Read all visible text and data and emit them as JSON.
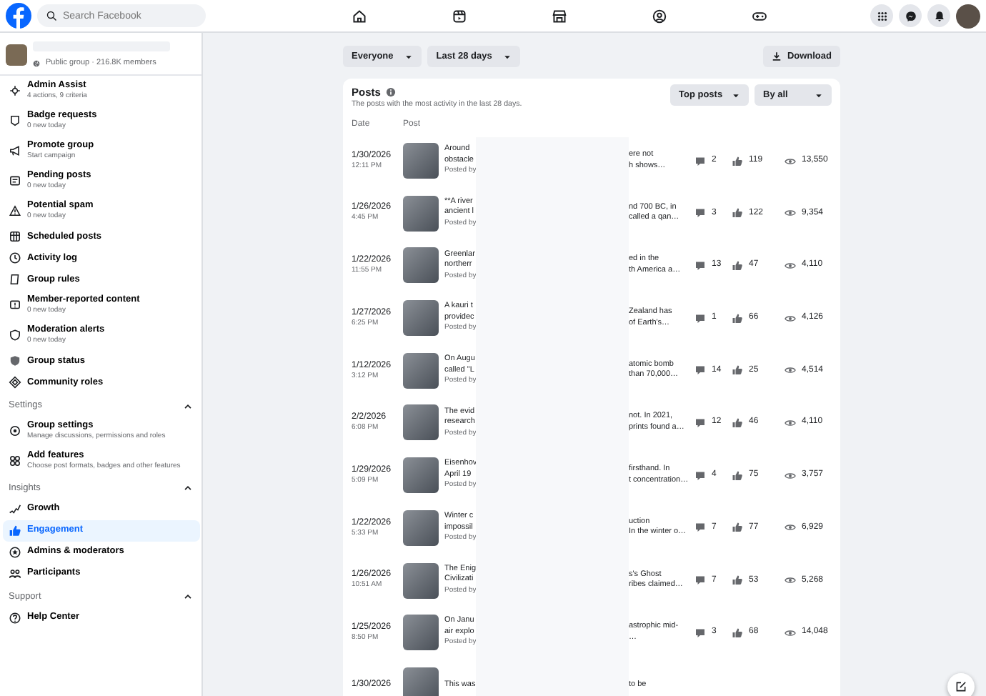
{
  "search": {
    "placeholder": "Search Facebook"
  },
  "sidebar": {
    "group_meta": "Public group · 216.8K members",
    "items": [
      {
        "kind": "item",
        "label": "Admin Assist",
        "sub": "4 actions, 9 criteria",
        "selected": false
      },
      {
        "kind": "item",
        "label": "Badge requests",
        "sub": "0 new today",
        "selected": false
      },
      {
        "kind": "item",
        "label": "Promote group",
        "sub": "Start campaign",
        "selected": false
      },
      {
        "kind": "item",
        "label": "Pending posts",
        "sub": "0 new today",
        "selected": false
      },
      {
        "kind": "item",
        "label": "Potential spam",
        "sub": "0 new today",
        "selected": false
      },
      {
        "kind": "item",
        "label": "Scheduled posts",
        "selected": false
      },
      {
        "kind": "item",
        "label": "Activity log",
        "selected": false
      },
      {
        "kind": "item",
        "label": "Group rules",
        "selected": false
      },
      {
        "kind": "item",
        "label": "Member-reported content",
        "sub": "0 new today",
        "selected": false
      },
      {
        "kind": "item",
        "label": "Moderation alerts",
        "sub": "0 new today",
        "selected": false
      },
      {
        "kind": "item",
        "label": "Group status",
        "selected": false
      },
      {
        "kind": "item",
        "label": "Community roles",
        "selected": false
      },
      {
        "kind": "section",
        "label": "Settings",
        "expanded": true
      },
      {
        "kind": "item",
        "label": "Group settings",
        "sub": "Manage discussions, permissions and roles",
        "selected": false
      },
      {
        "kind": "item",
        "label": "Add features",
        "sub": "Choose post formats, badges and other features",
        "selected": false
      },
      {
        "kind": "section",
        "label": "Insights",
        "expanded": true
      },
      {
        "kind": "item",
        "label": "Growth",
        "selected": false
      },
      {
        "kind": "item",
        "label": "Engagement",
        "selected": true
      },
      {
        "kind": "item",
        "label": "Admins & moderators",
        "selected": false
      },
      {
        "kind": "item",
        "label": "Participants",
        "selected": false
      },
      {
        "kind": "section",
        "label": "Support",
        "expanded": true
      },
      {
        "kind": "item",
        "label": "Help Center",
        "selected": false
      }
    ]
  },
  "filters": [
    "Everyone",
    "Last 28 days"
  ],
  "download": "Download",
  "posts": {
    "title": "Posts",
    "subtitle": "The posts with the most activity in the last 28 days.",
    "sort": [
      "Top posts",
      "By all"
    ],
    "columns": [
      "Date",
      "Post"
    ],
    "rows": [
      {
        "date": "1/30/2026",
        "time": "12:11 PM",
        "start": [
          "Around",
          "obstacle"
        ],
        "end": [
          "ere not",
          "h shows…"
        ],
        "posted_by": "Posted by",
        "comments": "2",
        "likes": "119",
        "views": "13,550"
      },
      {
        "date": "1/26/2026",
        "time": "4:45 PM",
        "start": [
          "**A river",
          "ancient l"
        ],
        "end": [
          "nd 700 BC, in",
          "called a qan…"
        ],
        "posted_by": "Posted by",
        "comments": "3",
        "likes": "122",
        "views": "9,354"
      },
      {
        "date": "1/22/2026",
        "time": "11:55 PM",
        "start": [
          "Greenlar",
          "northerr"
        ],
        "end": [
          "ed in the",
          "th America a…"
        ],
        "posted_by": "Posted by",
        "comments": "13",
        "likes": "47",
        "views": "4,110"
      },
      {
        "date": "1/27/2026",
        "time": "6:25 PM",
        "start": [
          "A kauri t",
          "providec"
        ],
        "end": [
          "Zealand has",
          "of Earth's…"
        ],
        "posted_by": "Posted by",
        "comments": "1",
        "likes": "66",
        "views": "4,126"
      },
      {
        "date": "1/12/2026",
        "time": "3:12 PM",
        "start": [
          "On Augu",
          "called \"L"
        ],
        "end": [
          "atomic bomb",
          "than 70,000…"
        ],
        "posted_by": "Posted by",
        "comments": "14",
        "likes": "25",
        "views": "4,514"
      },
      {
        "date": "2/2/2026",
        "time": "6:08 PM",
        "start": [
          "The evid",
          "research"
        ],
        "end": [
          "not. In 2021,",
          "prints found a…"
        ],
        "posted_by": "Posted by",
        "comments": "12",
        "likes": "46",
        "views": "4,110"
      },
      {
        "date": "1/29/2026",
        "time": "5:09 PM",
        "start": [
          "Eisenhov",
          "April 19"
        ],
        "end": [
          "firsthand. In",
          "t concentration…"
        ],
        "posted_by": "Posted by",
        "comments": "4",
        "likes": "75",
        "views": "3,757"
      },
      {
        "date": "1/22/2026",
        "time": "5:33 PM",
        "start": [
          "Winter c",
          "impossil"
        ],
        "end": [
          "uction",
          "In the winter o…"
        ],
        "posted_by": "Posted by",
        "comments": "7",
        "likes": "77",
        "views": "6,929"
      },
      {
        "date": "1/26/2026",
        "time": "10:51 AM",
        "start": [
          "The Enig",
          "Civilizati"
        ],
        "end": [
          "s's Ghost",
          "ribes claimed…"
        ],
        "posted_by": "Posted by",
        "comments": "7",
        "likes": "53",
        "views": "5,268"
      },
      {
        "date": "1/25/2026",
        "time": "8:50 PM",
        "start": [
          "On Janu",
          "air explo"
        ],
        "end": [
          "astrophic mid-",
          "…"
        ],
        "posted_by": "Posted by",
        "comments": "3",
        "likes": "68",
        "views": "14,048"
      },
      {
        "date": "1/30/2026",
        "start": [
          "This was"
        ],
        "end": [
          "to be"
        ]
      }
    ]
  }
}
